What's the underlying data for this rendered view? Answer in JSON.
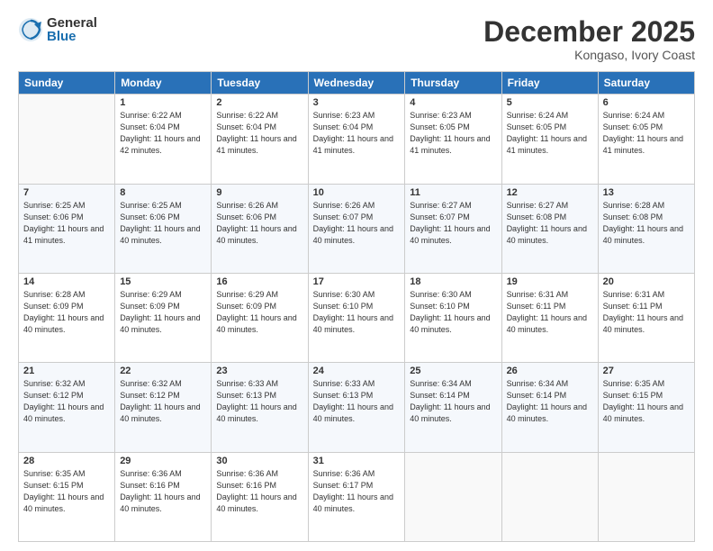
{
  "header": {
    "logo_general": "General",
    "logo_blue": "Blue",
    "title": "December 2025",
    "subtitle": "Kongaso, Ivory Coast"
  },
  "weekdays": [
    "Sunday",
    "Monday",
    "Tuesday",
    "Wednesday",
    "Thursday",
    "Friday",
    "Saturday"
  ],
  "weeks": [
    [
      {
        "day": "",
        "empty": true
      },
      {
        "day": "1",
        "sunrise": "6:22 AM",
        "sunset": "6:04 PM",
        "daylight": "11 hours and 42 minutes."
      },
      {
        "day": "2",
        "sunrise": "6:22 AM",
        "sunset": "6:04 PM",
        "daylight": "11 hours and 41 minutes."
      },
      {
        "day": "3",
        "sunrise": "6:23 AM",
        "sunset": "6:04 PM",
        "daylight": "11 hours and 41 minutes."
      },
      {
        "day": "4",
        "sunrise": "6:23 AM",
        "sunset": "6:05 PM",
        "daylight": "11 hours and 41 minutes."
      },
      {
        "day": "5",
        "sunrise": "6:24 AM",
        "sunset": "6:05 PM",
        "daylight": "11 hours and 41 minutes."
      },
      {
        "day": "6",
        "sunrise": "6:24 AM",
        "sunset": "6:05 PM",
        "daylight": "11 hours and 41 minutes."
      }
    ],
    [
      {
        "day": "7",
        "sunrise": "6:25 AM",
        "sunset": "6:06 PM",
        "daylight": "11 hours and 41 minutes."
      },
      {
        "day": "8",
        "sunrise": "6:25 AM",
        "sunset": "6:06 PM",
        "daylight": "11 hours and 40 minutes."
      },
      {
        "day": "9",
        "sunrise": "6:26 AM",
        "sunset": "6:06 PM",
        "daylight": "11 hours and 40 minutes."
      },
      {
        "day": "10",
        "sunrise": "6:26 AM",
        "sunset": "6:07 PM",
        "daylight": "11 hours and 40 minutes."
      },
      {
        "day": "11",
        "sunrise": "6:27 AM",
        "sunset": "6:07 PM",
        "daylight": "11 hours and 40 minutes."
      },
      {
        "day": "12",
        "sunrise": "6:27 AM",
        "sunset": "6:08 PM",
        "daylight": "11 hours and 40 minutes."
      },
      {
        "day": "13",
        "sunrise": "6:28 AM",
        "sunset": "6:08 PM",
        "daylight": "11 hours and 40 minutes."
      }
    ],
    [
      {
        "day": "14",
        "sunrise": "6:28 AM",
        "sunset": "6:09 PM",
        "daylight": "11 hours and 40 minutes."
      },
      {
        "day": "15",
        "sunrise": "6:29 AM",
        "sunset": "6:09 PM",
        "daylight": "11 hours and 40 minutes."
      },
      {
        "day": "16",
        "sunrise": "6:29 AM",
        "sunset": "6:09 PM",
        "daylight": "11 hours and 40 minutes."
      },
      {
        "day": "17",
        "sunrise": "6:30 AM",
        "sunset": "6:10 PM",
        "daylight": "11 hours and 40 minutes."
      },
      {
        "day": "18",
        "sunrise": "6:30 AM",
        "sunset": "6:10 PM",
        "daylight": "11 hours and 40 minutes."
      },
      {
        "day": "19",
        "sunrise": "6:31 AM",
        "sunset": "6:11 PM",
        "daylight": "11 hours and 40 minutes."
      },
      {
        "day": "20",
        "sunrise": "6:31 AM",
        "sunset": "6:11 PM",
        "daylight": "11 hours and 40 minutes."
      }
    ],
    [
      {
        "day": "21",
        "sunrise": "6:32 AM",
        "sunset": "6:12 PM",
        "daylight": "11 hours and 40 minutes."
      },
      {
        "day": "22",
        "sunrise": "6:32 AM",
        "sunset": "6:12 PM",
        "daylight": "11 hours and 40 minutes."
      },
      {
        "day": "23",
        "sunrise": "6:33 AM",
        "sunset": "6:13 PM",
        "daylight": "11 hours and 40 minutes."
      },
      {
        "day": "24",
        "sunrise": "6:33 AM",
        "sunset": "6:13 PM",
        "daylight": "11 hours and 40 minutes."
      },
      {
        "day": "25",
        "sunrise": "6:34 AM",
        "sunset": "6:14 PM",
        "daylight": "11 hours and 40 minutes."
      },
      {
        "day": "26",
        "sunrise": "6:34 AM",
        "sunset": "6:14 PM",
        "daylight": "11 hours and 40 minutes."
      },
      {
        "day": "27",
        "sunrise": "6:35 AM",
        "sunset": "6:15 PM",
        "daylight": "11 hours and 40 minutes."
      }
    ],
    [
      {
        "day": "28",
        "sunrise": "6:35 AM",
        "sunset": "6:15 PM",
        "daylight": "11 hours and 40 minutes."
      },
      {
        "day": "29",
        "sunrise": "6:36 AM",
        "sunset": "6:16 PM",
        "daylight": "11 hours and 40 minutes."
      },
      {
        "day": "30",
        "sunrise": "6:36 AM",
        "sunset": "6:16 PM",
        "daylight": "11 hours and 40 minutes."
      },
      {
        "day": "31",
        "sunrise": "6:36 AM",
        "sunset": "6:17 PM",
        "daylight": "11 hours and 40 minutes."
      },
      {
        "day": "",
        "empty": true
      },
      {
        "day": "",
        "empty": true
      },
      {
        "day": "",
        "empty": true
      }
    ]
  ]
}
